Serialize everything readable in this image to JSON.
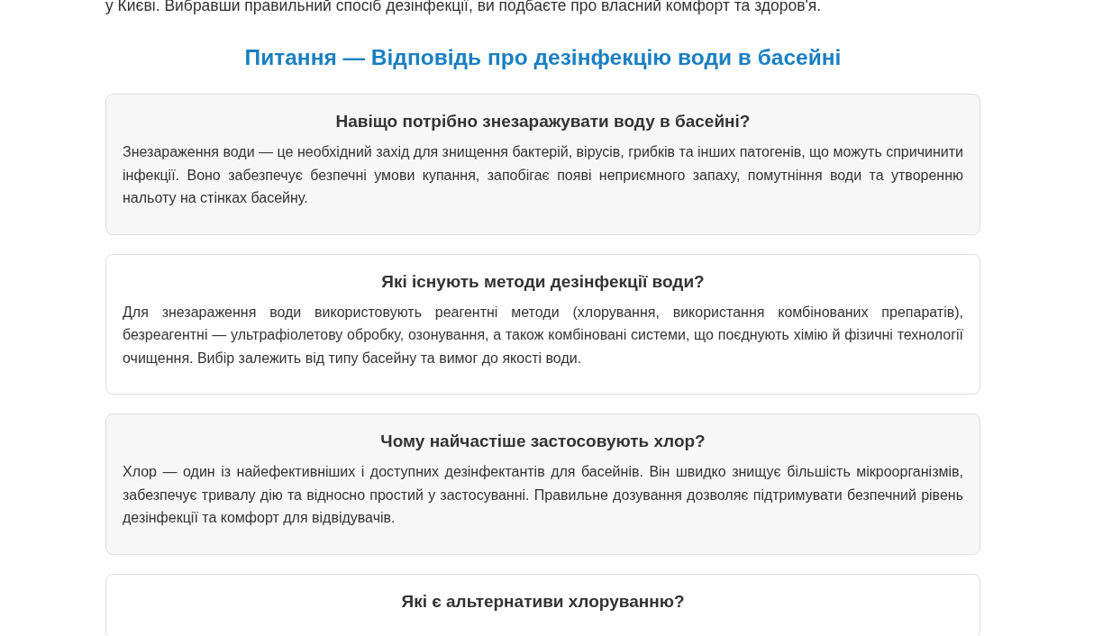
{
  "intro_tail": "у Києві. Вибравши правильний спосіб дезінфекції, ви подбаєте про власний комфорт та здоров'я.",
  "section_title": "Питання — Відповідь про дезінфекцію води в басейні",
  "faq": [
    {
      "question": "Навіщо потрібно знезаражувати воду в басейні?",
      "answer": "Знезараження води — це необхідний захід для знищення бактерій, вірусів, грибків та інших патогенів, що можуть спричинити інфекції. Воно забезпечує безпечні умови купання, запобігає появі неприємного запаху, помутніння води та утворенню нальоту на стінках басейну."
    },
    {
      "question": "Які існують методи дезінфекції води?",
      "answer": "Для знезараження води використовують реагентні методи (хлорування, використання комбінованих препаратів), безреагентні — ультрафіолетову обробку, озонування, а також комбіновані системи, що поєднують хімію й фізичні технології очищення. Вибір залежить від типу басейну та вимог до якості води."
    },
    {
      "question": "Чому найчастіше застосовують хлор?",
      "answer": "Хлор — один із найефективніших і доступних дезінфектантів для басейнів. Він швидко знищує більшість мікроорганізмів, забезпечує тривалу дію та відносно простий у застосуванні. Правильне дозування дозволяє підтримувати безпечний рівень дезінфекції та комфорт для відвідувачів."
    },
    {
      "question": "Які є альтернативи хлоруванню?"
    }
  ]
}
